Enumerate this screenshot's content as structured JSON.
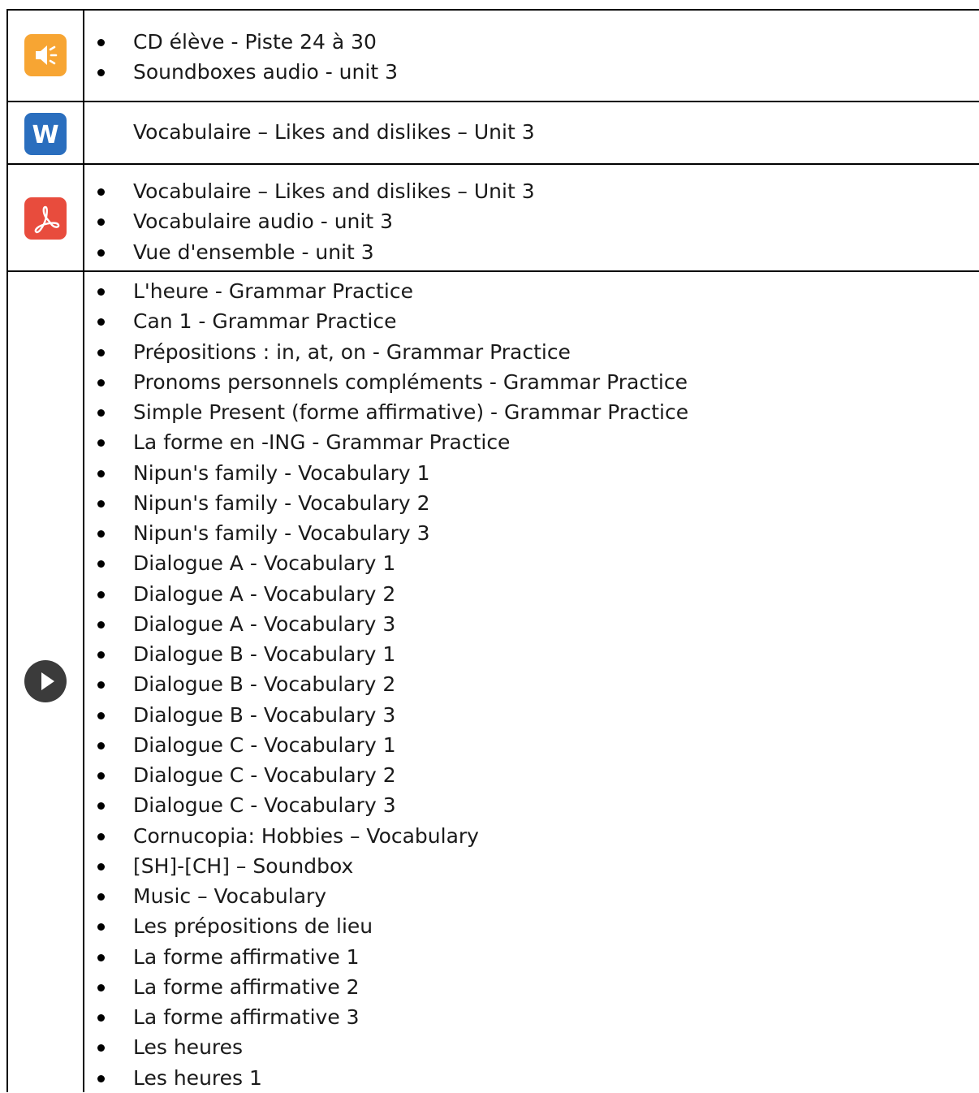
{
  "rows": [
    {
      "icon": "speaker-icon",
      "color": "#f7a533",
      "items": [
        "CD élève  - Piste 24 à 30",
        "Soundboxes audio - unit 3"
      ]
    },
    {
      "icon": "word-icon",
      "color": "#2a6ebe",
      "text": "Vocabulaire – Likes and dislikes – Unit 3",
      "icon_letter": "W"
    },
    {
      "icon": "pdf-icon",
      "color": "#e84c3d",
      "items": [
        "Vocabulaire – Likes and dislikes – Unit 3",
        "Vocabulaire audio - unit 3",
        "Vue d'ensemble - unit 3"
      ]
    },
    {
      "icon": "play-icon",
      "color": "#3b3b3b",
      "items": [
        "L'heure - Grammar Practice",
        "Can 1 - Grammar Practice",
        "Prépositions : in, at, on - Grammar Practice",
        "Pronoms personnels compléments - Grammar Practice",
        "Simple Present (forme affirmative) - Grammar Practice",
        "La forme en -ING - Grammar Practice",
        "Nipun's family - Vocabulary 1",
        "Nipun's family - Vocabulary 2",
        "Nipun's family - Vocabulary 3",
        "Dialogue A - Vocabulary 1",
        "Dialogue A - Vocabulary 2",
        "Dialogue A - Vocabulary 3",
        "Dialogue B - Vocabulary 1",
        "Dialogue B - Vocabulary 2",
        "Dialogue B - Vocabulary 3",
        "Dialogue C - Vocabulary 1",
        "Dialogue C - Vocabulary 2",
        "Dialogue C - Vocabulary 3",
        "Cornucopia: Hobbies – Vocabulary",
        "[SH]-[CH] – Soundbox",
        "Music – Vocabulary",
        "Les prépositions de lieu",
        "La forme affirmative 1",
        "La forme affirmative 2",
        "La forme affirmative 3",
        "Les heures",
        "Les heures 1"
      ]
    }
  ]
}
